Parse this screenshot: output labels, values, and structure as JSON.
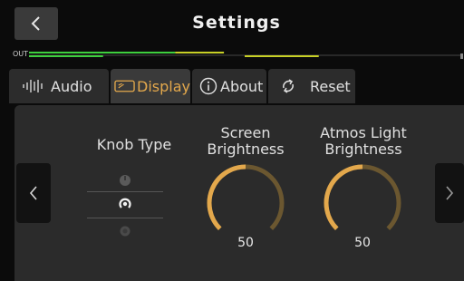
{
  "header": {
    "title": "Settings",
    "back_icon": "chevron-left-icon"
  },
  "meter": {
    "label": "OUT",
    "level_1": 0.45,
    "level_2": 0.38
  },
  "tabs": [
    {
      "label": "Audio",
      "icon": "waveform-icon",
      "active": false
    },
    {
      "label": "Display",
      "icon": "display-icon",
      "active": true
    },
    {
      "label": "About",
      "icon": "info-icon",
      "active": false
    },
    {
      "label": "Reset",
      "icon": "refresh-icon",
      "active": false
    }
  ],
  "display": {
    "knob_type": {
      "title": "Knob Type",
      "options": [
        "knob-style-1-icon",
        "knob-style-2-icon",
        "knob-style-3-icon"
      ],
      "selected_index": 1
    },
    "screen_brightness": {
      "title_line1": "Screen",
      "title_line2": "Brightness",
      "value": "50",
      "fraction": 0.5
    },
    "atmos_light_brightness": {
      "title_line1": "Atmos Light",
      "title_line2": "Brightness",
      "value": "50",
      "fraction": 0.5
    }
  },
  "colors": {
    "accent": "#e3a84c",
    "meter_green": "#3ecf3e",
    "meter_yellow": "#c8d026",
    "dial_track": "#6b5730",
    "panel": "#2b2b2b"
  }
}
